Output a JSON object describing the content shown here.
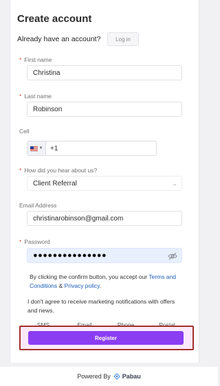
{
  "form": {
    "title": "Create account",
    "already_text": "Already have an account?",
    "login_label": "Log in",
    "first_name": {
      "label": "First name",
      "value": "Christina"
    },
    "last_name": {
      "label": "Last name",
      "value": "Robinson"
    },
    "cell": {
      "label": "Cell",
      "country_code": "+1"
    },
    "referral": {
      "label": "How did you hear about us?",
      "value": "Client Referral"
    },
    "email": {
      "label": "Email Address",
      "value": "christinarobinson@gmail.com"
    },
    "password": {
      "label": "Password",
      "value": "●●●●●●●●●●●●●●●"
    },
    "terms": {
      "prefix": "By clicking the confirm button, you accept our ",
      "terms_link": "Terms and Conditions",
      "amp": " & ",
      "privacy_link": "Privacy policy",
      "suffix": "."
    },
    "notify_text": "I don't agree to receive marketing notifications with offers and news.",
    "channels": [
      "SMS",
      "Email",
      "Phone",
      "Postal"
    ],
    "register_label": "Register"
  },
  "footer": {
    "powered_by": "Powered By",
    "brand": "Pabau"
  },
  "colors": {
    "accent": "#8b3df2",
    "link": "#1a5bb8",
    "required": "#e74c3c",
    "highlight_border": "#a3302a"
  }
}
